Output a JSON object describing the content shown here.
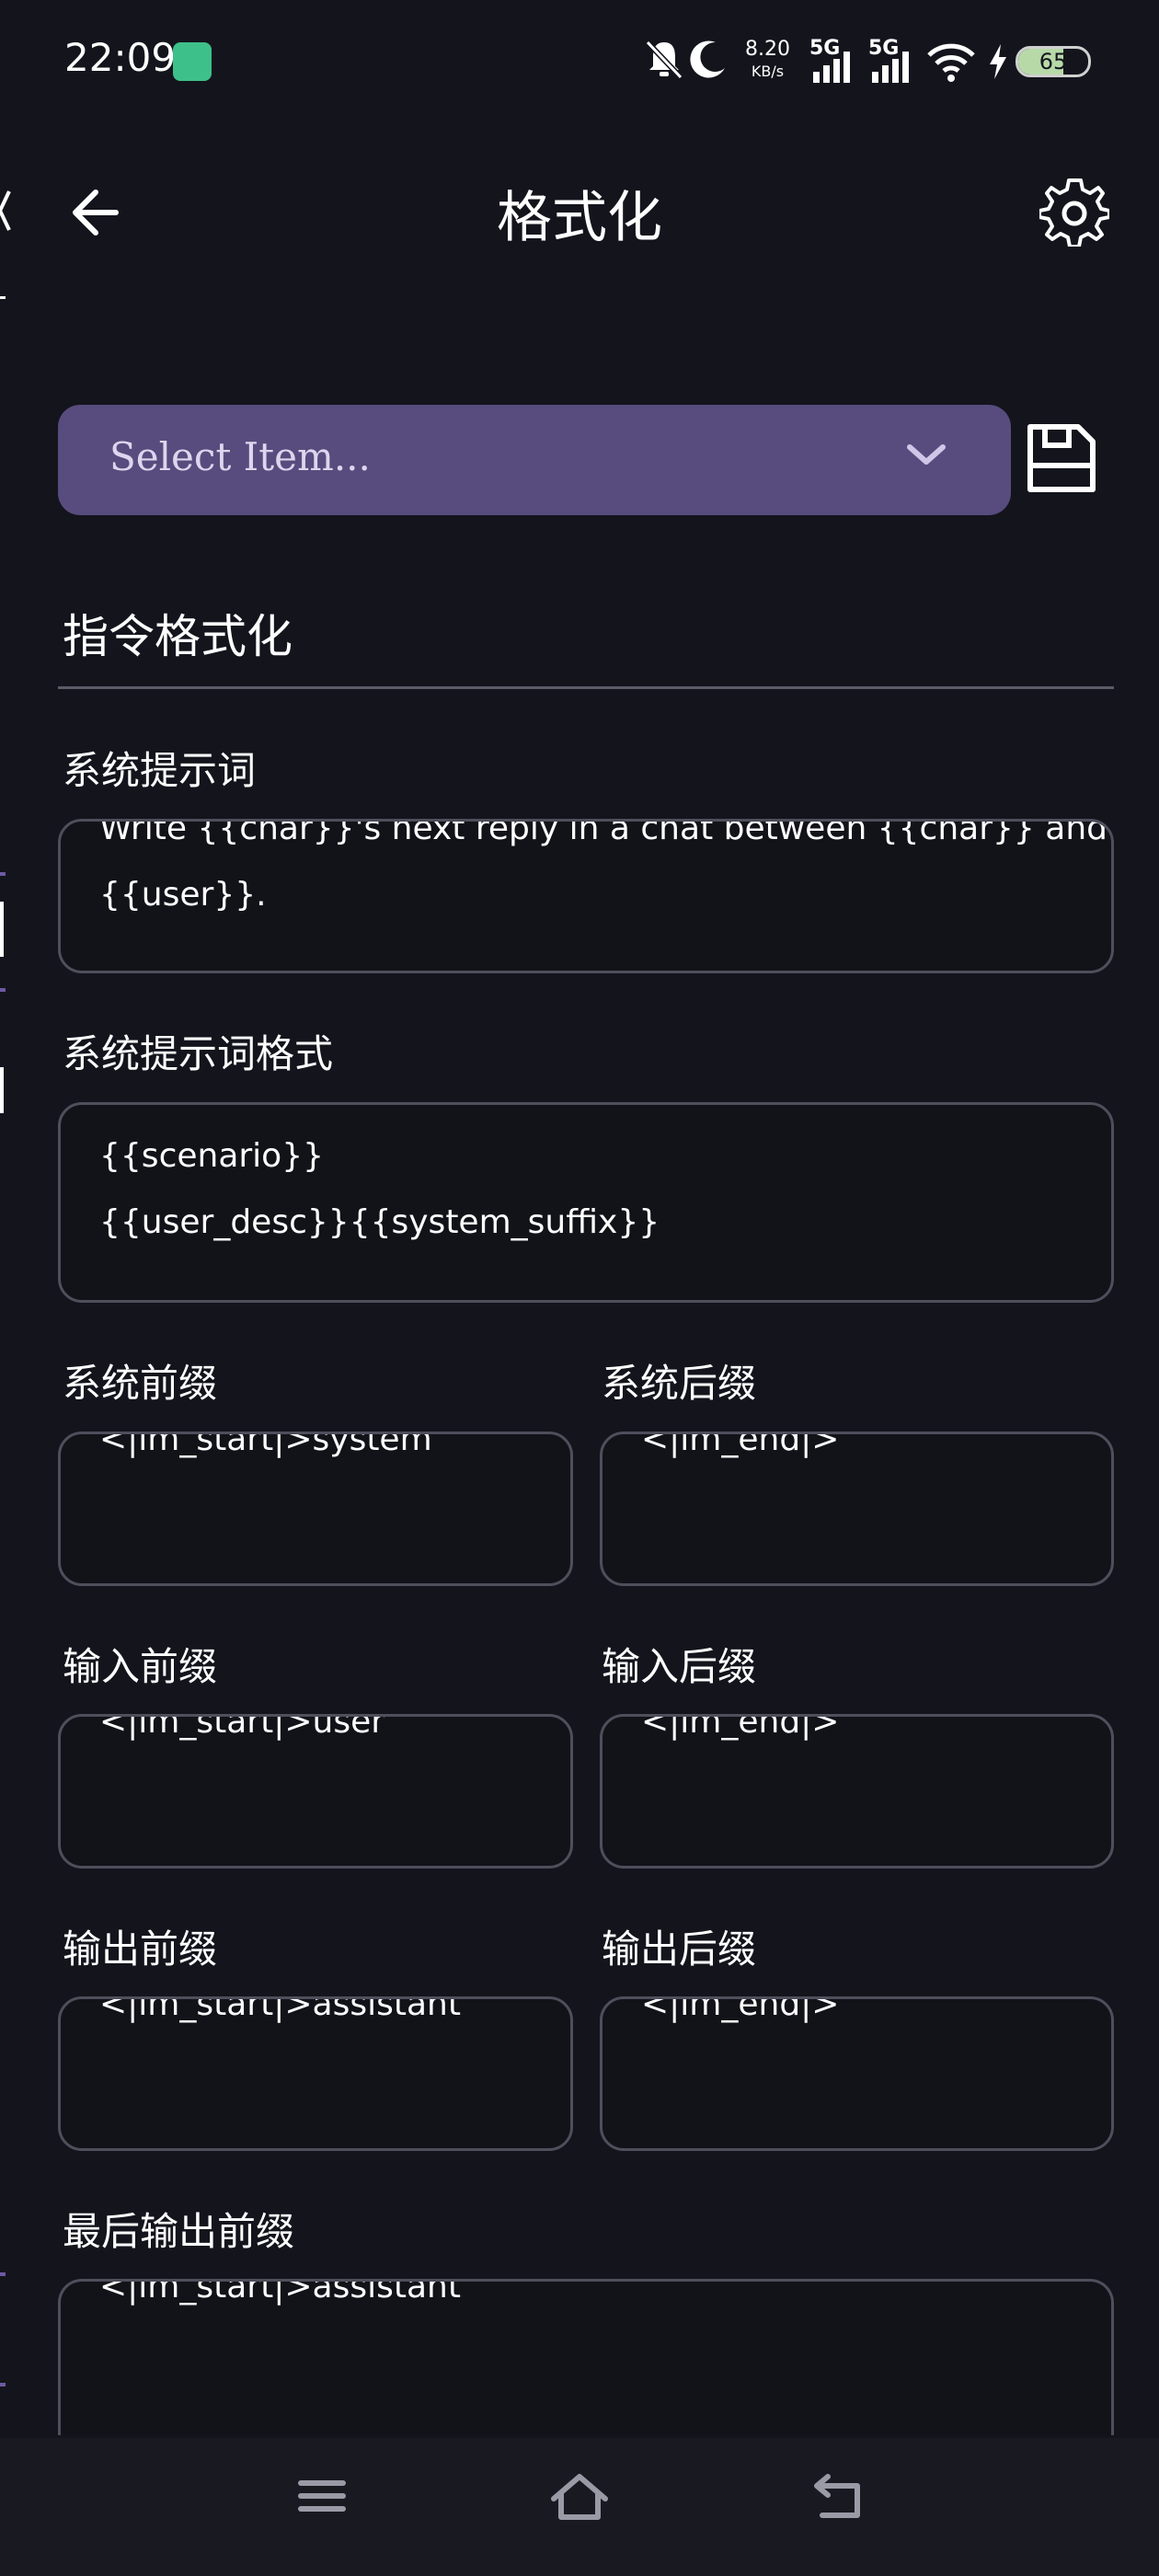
{
  "status_bar": {
    "time": "22:09",
    "net_speed_value": "8.20",
    "net_speed_unit": "KB/s",
    "signal_1": "5G",
    "signal_2": "5G",
    "battery_level": "65",
    "battery_fraction": 0.65
  },
  "header": {
    "title": "格式化",
    "back_icon": "arrow-left-icon",
    "settings_icon": "gear-icon"
  },
  "preset_select": {
    "placeholder": "Select Item...",
    "save_icon": "save-icon"
  },
  "section": {
    "title": "指令格式化"
  },
  "fields": {
    "system_prompt": {
      "label": "系统提示词",
      "line1": "Write {{char}}'s next reply in a chat between {{char}} and",
      "line2": "{{user}}."
    },
    "system_prompt_format": {
      "label": "系统提示词格式",
      "line1": "{{scenario}}",
      "line2": "{{user_desc}}{{system_suffix}}"
    },
    "system_prefix": {
      "label": "系统前缀",
      "value": "<|im_start|>system"
    },
    "system_suffix": {
      "label": "系统后缀",
      "value": "<|im_end|>"
    },
    "input_prefix": {
      "label": "输入前缀",
      "value": "<|im_start|>user"
    },
    "input_suffix": {
      "label": "输入后缀",
      "value": "<|im_end|>"
    },
    "output_prefix": {
      "label": "输出前缀",
      "value": "<|im_start|>assistant"
    },
    "output_suffix": {
      "label": "输出后缀",
      "value": "<|im_end|>"
    },
    "last_output_prefix": {
      "label": "最后输出前缀",
      "value": "<|im_start|>assistant"
    }
  },
  "nav_bar": {
    "menu_icon": "menu-icon",
    "home_icon": "home-icon",
    "back_icon": "back-icon"
  },
  "colors": {
    "background": "#14141d",
    "select_bg": "#584c7e",
    "border": "#4f4e5b",
    "accent": "#6b5aa2"
  }
}
